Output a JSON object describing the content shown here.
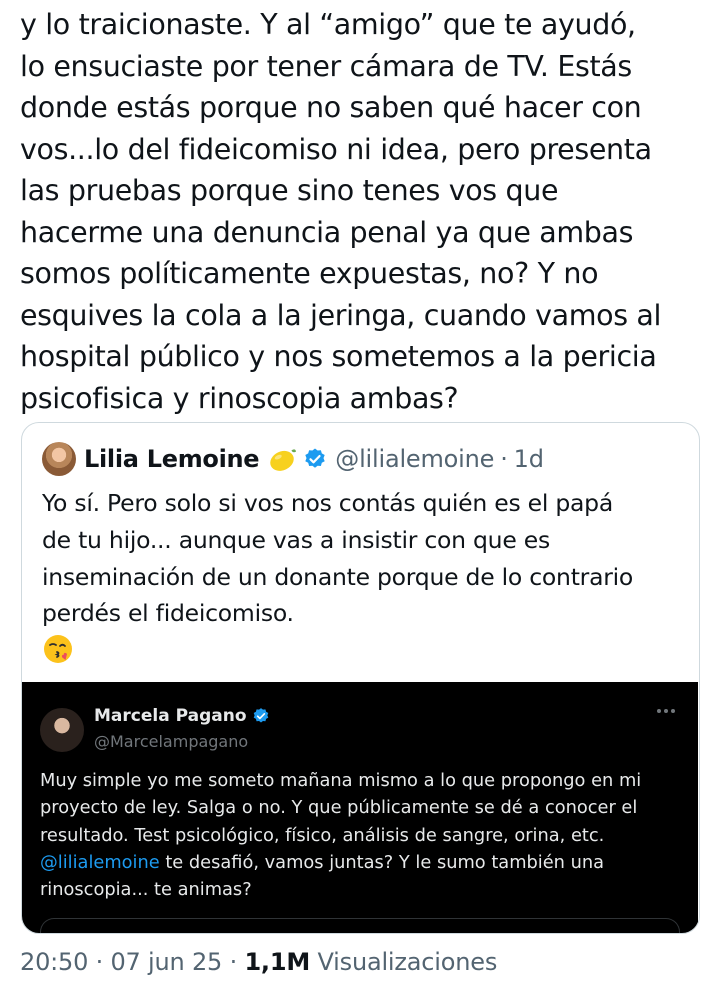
{
  "tweet": {
    "text": "y lo traicionaste. Y al “amigo” que te ayudó,\nlo ensuciaste por tener cámara de TV. Estás\ndonde estás porque no saben qué hacer con\nvos...lo del fideicomiso ni idea, pero presenta\nlas pruebas porque sino tenes vos que\nhacerme una denuncia penal ya que ambas\nsomos políticamente expuestas, no? Y no\nesquives la cola a la jeringa, cuando vamos al\nhospital público y nos sometemos a la pericia\npsicofisica y rinoscopia ambas?"
  },
  "quote": {
    "author_name": "Lilia Lemoine",
    "emoji_icon": "lemon-icon",
    "verified_icon": "verified-badge-icon",
    "handle": "@lilialemoine",
    "separator": "·",
    "time": "1d",
    "text": "Yo sí. Pero solo si vos nos contás quién es el papá\nde tu hijo... aunque vas a insistir con que es\ninseminación de un donante porque de lo contrario\nperdés el fideicomiso.",
    "trailing_emoji_icon": "face-blowing-kiss-icon"
  },
  "screenshot": {
    "author_name": "Marcela Pagano",
    "handle": "@Marcelampagano",
    "text_before_mention": "Muy simple yo me someto mañana mismo a lo que propongo en mi\nproyecto de ley. Salga o no. Y que públicamente se dé a conocer el\nresultado. Test psicológico, físico, análisis de sangre, orina, etc.\n",
    "mention": "@lilialemoine",
    "text_after_mention": " te desafió, vamos juntas? Y le sumo también una\nrinoscopia... te animas?",
    "more_icon": "more-dots-icon"
  },
  "meta": {
    "time": "20:50",
    "date": "07 jun 25",
    "views_count": "1,1M",
    "views_label": "Visualizaciones",
    "separator": "·"
  },
  "colors": {
    "text": "#0f1419",
    "secondary": "#536471",
    "verified": "#1d9bf0",
    "dark_bg": "#000000"
  }
}
